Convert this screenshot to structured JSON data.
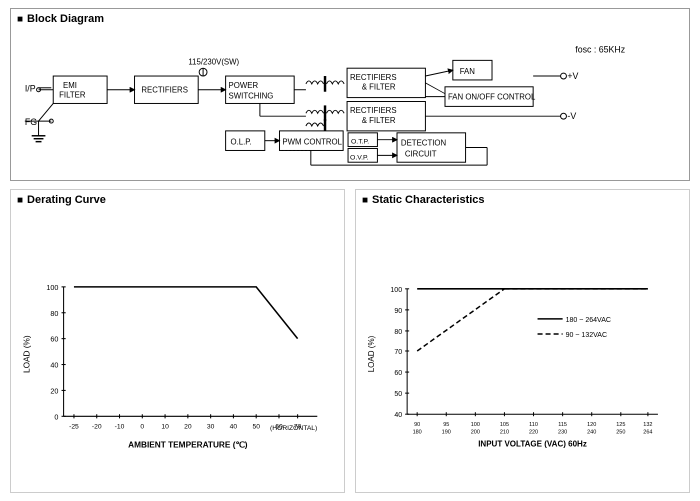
{
  "blockDiagram": {
    "title": "Block Diagram",
    "voltage": "115/230V(SW)",
    "fosc": "fosc : 65KHz",
    "components": [
      "I/P",
      "FG",
      "EMI FILTER",
      "RECTIFIERS",
      "POWER SWITCHING",
      "RECTIFIERS & FILTER",
      "RECTIFIERS & FILTER",
      "FAN",
      "FAN ON/OFF CONTROL",
      "O.L.P.",
      "PWM CONTROL",
      "O.T.P.",
      "O.V.P.",
      "DETECTION CIRCUIT",
      "+V",
      "-V"
    ]
  },
  "deratingCurve": {
    "title": "Derating Curve",
    "xLabel": "AMBIENT TEMPERATURE (℃)",
    "yLabel": "LOAD (%)",
    "xAxisLabel": "HORIZONTAL",
    "xTicks": [
      "-25",
      "-20",
      "-10",
      "0",
      "10",
      "20",
      "30",
      "40",
      "50",
      "60",
      "70"
    ],
    "yTicks": [
      "0",
      "20",
      "40",
      "60",
      "80",
      "100"
    ]
  },
  "staticCharacteristics": {
    "title": "Static Characteristics",
    "xLabel": "INPUT VOLTAGE (VAC) 60Hz",
    "yLabel": "LOAD (%)",
    "xTicks": [
      "90",
      "95",
      "100",
      "105",
      "110",
      "115",
      "120",
      "125",
      "132"
    ],
    "xTicksRow2": [
      "180",
      "190",
      "200",
      "210",
      "220",
      "230",
      "240",
      "250",
      "264"
    ],
    "yTicks": [
      "40",
      "50",
      "60",
      "70",
      "80",
      "90",
      "100"
    ],
    "legend": [
      {
        "label": "180 ~ 264VAC",
        "style": "solid"
      },
      {
        "label": "90 ~ 132VAC",
        "style": "dashed"
      }
    ]
  }
}
